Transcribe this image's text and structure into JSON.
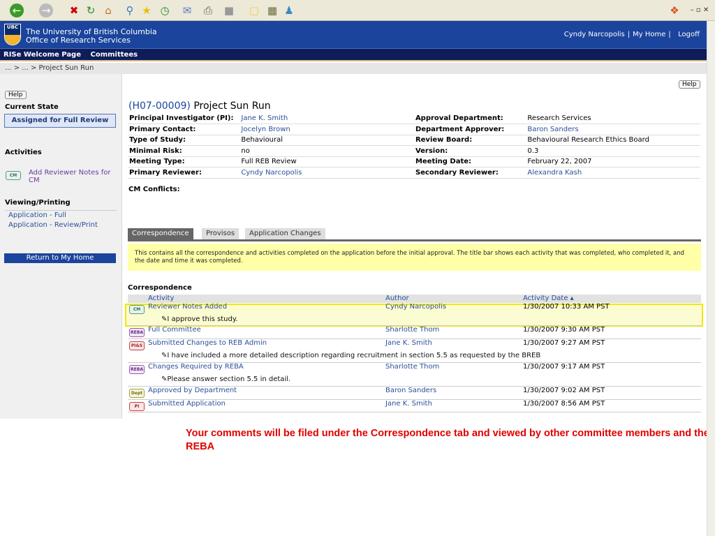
{
  "header": {
    "line1": "The University of British Columbia",
    "line2": "Office of Research Services",
    "logo_text": "UBC",
    "user": "Cyndy Narcopolis",
    "home": "My Home",
    "logoff": "Logoff",
    "sep": "|"
  },
  "nav": [
    "RISe Welcome Page",
    "Committees"
  ],
  "breadcrumb": "... > ... > Project Sun Run",
  "sidebar": {
    "help": "Help",
    "current_state_label": "Current State",
    "current_state": "Assigned for Full Review",
    "activities_label": "Activities",
    "activity_badge": "CM",
    "activity": "Add Reviewer Notes for CM",
    "viewing_label": "Viewing/Printing",
    "viewing": [
      "Application - Full",
      "Application - Review/Print"
    ],
    "return": "Return to My Home"
  },
  "main": {
    "help": "Help",
    "id": "(H07-00009)",
    "title": "Project Sun Run",
    "details": [
      [
        "Principal Investigator (PI):",
        "Jane K. Smith",
        "Approval Department:",
        "Research Services"
      ],
      [
        "Primary Contact:",
        "Jocelyn Brown",
        "Department Approver:",
        "Baron Sanders"
      ],
      [
        "Type of Study:",
        "Behavioural",
        "Review Board:",
        "Behavioural Research Ethics Board"
      ],
      [
        "Minimal Risk:",
        "no",
        "Version:",
        "0.3"
      ],
      [
        "Meeting Type:",
        "Full REB Review",
        "Meeting Date:",
        "February 22, 2007"
      ],
      [
        "Primary Reviewer:",
        "Cyndy Narcopolis",
        "Secondary Reviewer:",
        "Alexandra Kash"
      ]
    ],
    "conflicts": "CM Conflicts:",
    "tabs": [
      "Correspondence",
      "Provisos",
      "Application Changes"
    ],
    "info": "This contains all the correspondence and activities completed on the application before the initial approval. The title bar shows each activity that was completed, who completed it, and the date and time it was completed.",
    "corr_title": "Correspondence",
    "columns": [
      "Activity",
      "Author",
      "Activity Date ▴"
    ],
    "rows": [
      {
        "badge": "CM",
        "activity": "Reviewer Notes Added",
        "author": "Cyndy Narcopolis",
        "date": "1/30/2007 10:33 AM PST",
        "note": "I approve this study."
      },
      {
        "badge": "REBA",
        "activity": "Full Committee",
        "author": "Sharlotte Thom",
        "date": "1/30/2007 9:30 AM PST"
      },
      {
        "badge": "PI&S",
        "activity": "Submitted Changes to REB Admin",
        "author": "Jane K. Smith",
        "date": "1/30/2007 9:27 AM PST",
        "note": "I have included a more detailed description regarding recruitment in section 5.5 as requested by the BREB"
      },
      {
        "badge": "REBA",
        "activity": "Changes Required by REBA",
        "author": "Sharlotte Thom",
        "date": "1/30/2007 9:17 AM PST",
        "note": "Please answer section 5.5 in detail."
      },
      {
        "badge": "Dept",
        "activity": "Approved by Department",
        "author": "Baron Sanders",
        "date": "1/30/2007 9:02 AM PST"
      },
      {
        "badge": "PI",
        "activity": "Submitted Application",
        "author": "Jane K. Smith",
        "date": "1/30/2007 8:56 AM PST"
      }
    ]
  },
  "caption": "Your comments will be filed under the Correspondence tab and viewed by other committee members and the REBA"
}
